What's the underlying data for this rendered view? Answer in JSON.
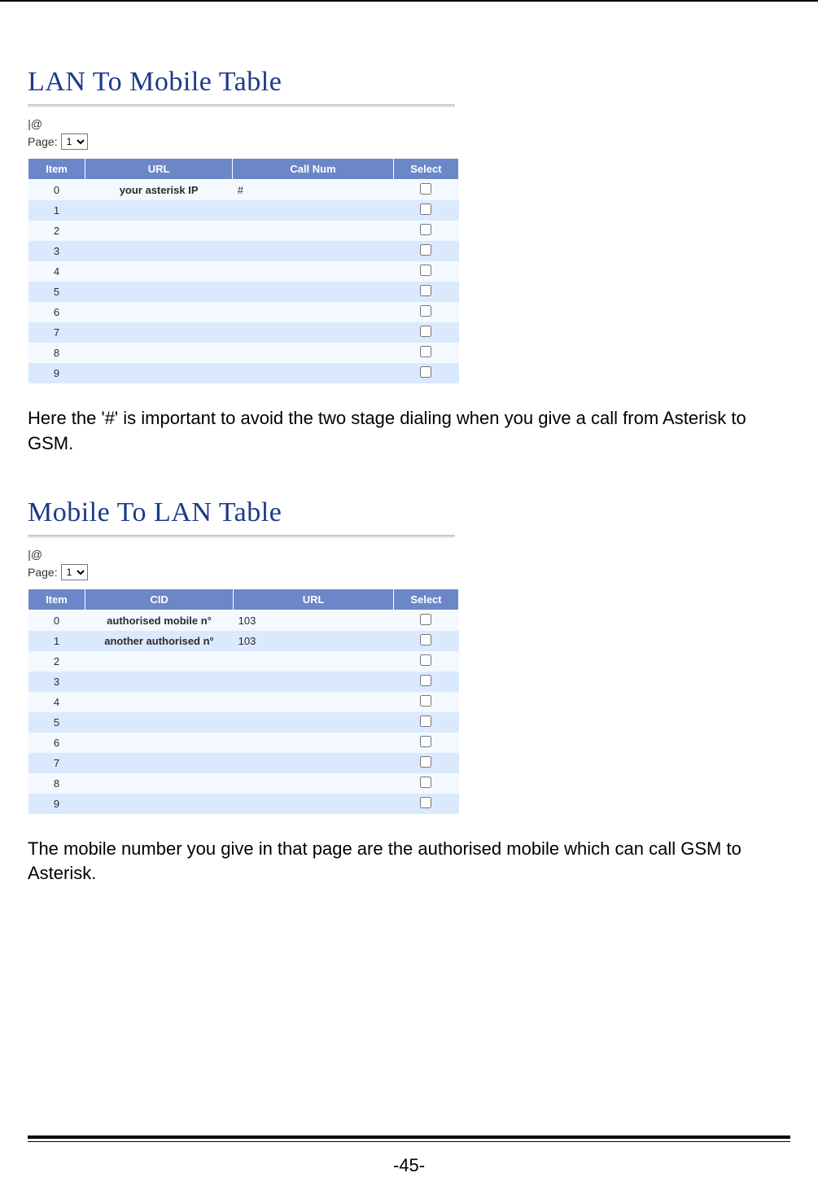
{
  "section1": {
    "title": "LAN To Mobile Table",
    "filter": "|@",
    "page_label": "Page:",
    "page_value": "1",
    "headers": [
      "Item",
      "URL",
      "Call Num",
      "Select"
    ],
    "rows": [
      {
        "item": "0",
        "url": "your asterisk IP",
        "call": "#",
        "select": false,
        "bold": true
      },
      {
        "item": "1",
        "url": "",
        "call": "",
        "select": false
      },
      {
        "item": "2",
        "url": "",
        "call": "",
        "select": false
      },
      {
        "item": "3",
        "url": "",
        "call": "",
        "select": false
      },
      {
        "item": "4",
        "url": "",
        "call": "",
        "select": false
      },
      {
        "item": "5",
        "url": "",
        "call": "",
        "select": false
      },
      {
        "item": "6",
        "url": "",
        "call": "",
        "select": false
      },
      {
        "item": "7",
        "url": "",
        "call": "",
        "select": false
      },
      {
        "item": "8",
        "url": "",
        "call": "",
        "select": false
      },
      {
        "item": "9",
        "url": "",
        "call": "",
        "select": false
      }
    ]
  },
  "para1": "Here the '#' is important to avoid the two stage dialing when you give a call from Asterisk to GSM.",
  "section2": {
    "title": "Mobile To LAN Table",
    "filter": "|@",
    "page_label": "Page:",
    "page_value": "1",
    "headers": [
      "Item",
      "CID",
      "URL",
      "Select"
    ],
    "rows": [
      {
        "item": "0",
        "cid": "authorised mobile n°",
        "url": "103",
        "select": false,
        "bold": true
      },
      {
        "item": "1",
        "cid": "another authorised n°",
        "url": "103",
        "select": false,
        "bold": true
      },
      {
        "item": "2",
        "cid": "",
        "url": "",
        "select": false
      },
      {
        "item": "3",
        "cid": "",
        "url": "",
        "select": false
      },
      {
        "item": "4",
        "cid": "",
        "url": "",
        "select": false
      },
      {
        "item": "5",
        "cid": "",
        "url": "",
        "select": false
      },
      {
        "item": "6",
        "cid": "",
        "url": "",
        "select": false
      },
      {
        "item": "7",
        "cid": "",
        "url": "",
        "select": false
      },
      {
        "item": "8",
        "cid": "",
        "url": "",
        "select": false
      },
      {
        "item": "9",
        "cid": "",
        "url": "",
        "select": false
      }
    ]
  },
  "para2": "The mobile number you give in that page are the authorised mobile which can call GSM to Asterisk.",
  "page_number": "-45-"
}
